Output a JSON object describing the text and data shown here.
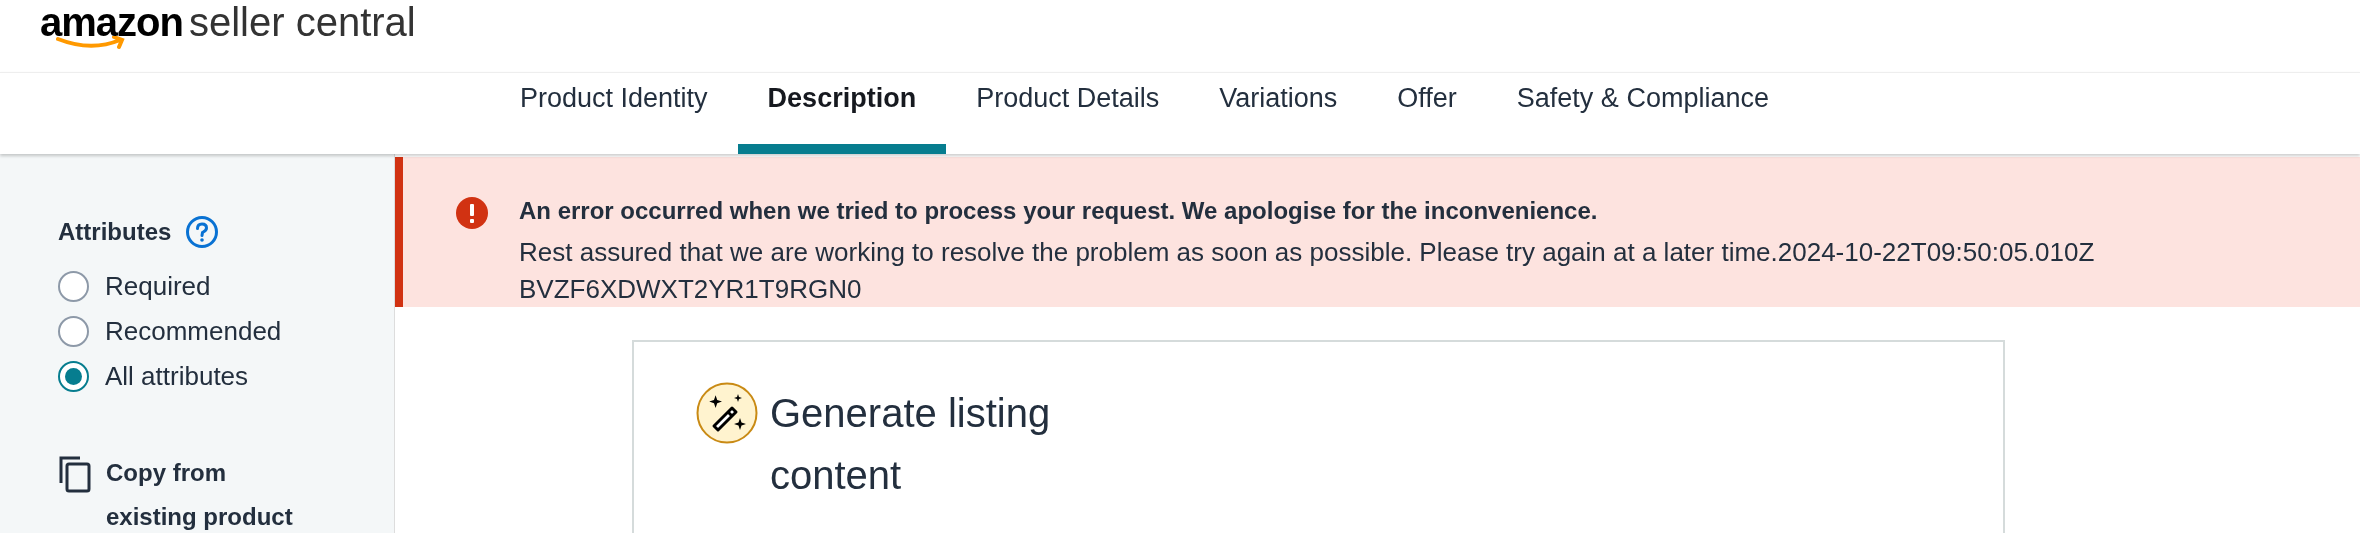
{
  "header": {
    "logo_brand": "amazon",
    "logo_product": "seller central"
  },
  "tabs": [
    {
      "label": "Product Identity",
      "selected": false
    },
    {
      "label": "Description",
      "selected": true
    },
    {
      "label": "Product Details",
      "selected": false
    },
    {
      "label": "Variations",
      "selected": false
    },
    {
      "label": "Offer",
      "selected": false
    },
    {
      "label": "Safety & Compliance",
      "selected": false
    }
  ],
  "sidebar": {
    "attributes_title": "Attributes",
    "filters": [
      {
        "label": "Required",
        "selected": false
      },
      {
        "label": "Recommended",
        "selected": false
      },
      {
        "label": "All attributes",
        "selected": true
      }
    ],
    "copy_action": "Copy from existing product"
  },
  "error": {
    "title": "An error occurred when we tried to process your request. We apologise for the inconvenience.",
    "message": "Rest assured that we are working to resolve the problem as soon as possible. Please try again at a later time.2024-10-22T09:50:05.010Z",
    "request_id": "BVZF6XDWXT2YR1T9RGN0"
  },
  "card": {
    "title": "Generate listing content"
  }
}
